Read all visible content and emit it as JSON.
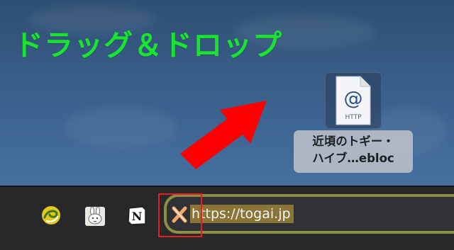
{
  "headline": "ドラッグ＆ドロップ",
  "colors": {
    "headline": "#18e62c",
    "arrow": "#ff0000",
    "highlight_box": "#e61e22",
    "url_frame": "#8f8c45",
    "url_selection": "#8a7436",
    "bar_background": "#27282a"
  },
  "desktop_file": {
    "icon": "webloc-file-icon",
    "icon_symbol": "@",
    "icon_caption": "HTTP",
    "label_line1": "近頃のトギー・",
    "label_line2": "ハイブ…ebloc"
  },
  "bookmarks": [
    {
      "icon": "yellow-swirl-icon"
    },
    {
      "icon": "rabbit-sticker-icon"
    },
    {
      "icon": "notion-icon",
      "glyph": "N"
    }
  ],
  "url_bar": {
    "favicon": "togai-x-icon",
    "url": "https://togai.jp"
  }
}
